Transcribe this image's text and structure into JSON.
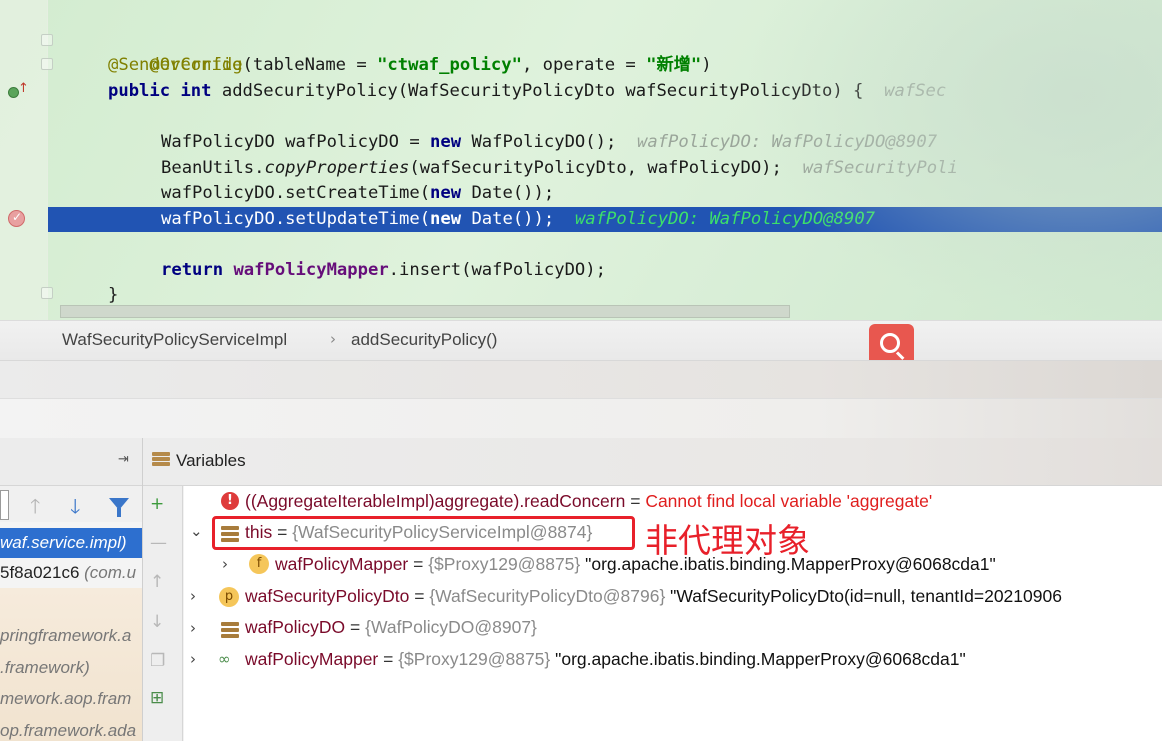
{
  "editor": {
    "lines": {
      "l1": "@Override",
      "l2_ann": "@SenderConfig",
      "l2_a": "(tableName = ",
      "l2_str1": "\"ctwaf_policy\"",
      "l2_b": ", operate = ",
      "l2_str2": "\"新增\"",
      "l2_c": ")",
      "l3_kw1": "public",
      "l3_kw2": "int",
      "l3_rest": " addSecurityPolicy(WafSecurityPolicyDto wafSecurityPolicyDto) {",
      "l3_inlay": "wafSec",
      "l5_a": "WafPolicyDO wafPolicyDO = ",
      "l5_kw": "new",
      "l5_b": " WafPolicyDO();",
      "l5_inlay": "wafPolicyDO: WafPolicyDO@8907",
      "l6_a": "BeanUtils.",
      "l6_it": "copyProperties",
      "l6_b": "(wafSecurityPolicyDto, wafPolicyDO);",
      "l6_inlay": "wafSecurityPoli",
      "l7_a": "wafPolicyDO.setCreateTime(",
      "l7_kw": "new",
      "l7_b": " Date());",
      "l8_a": "wafPolicyDO.setUpdateTime(",
      "l8_kw": "new",
      "l8_b": " Date());",
      "l8_inlay": "wafPolicyDO: WafPolicyDO@8907",
      "l10_kw": "return",
      "l10_field": "wafPolicyMapper",
      "l10_rest": ".insert(wafPolicyDO);",
      "l11": "}"
    }
  },
  "breadcrumbs": {
    "class_name": "WafSecurityPolicyServiceImpl",
    "separator": "›",
    "method_name": "addSecurityPolicy()"
  },
  "frames": {
    "selected": "waf.service.impl)",
    "row2_a": "5f8a021c6",
    "row2_b": "(com.u",
    "row3": "pringframework.a",
    "row4": ".framework)",
    "row5": "mework.aop.fram",
    "row6": "op.framework.ada"
  },
  "variables": {
    "title": "Variables",
    "rows": [
      {
        "name": "((AggregateIterableImpl)aggregate).readConcern",
        "eq": " = ",
        "value": "Cannot find local variable 'aggregate'"
      },
      {
        "name": "this",
        "eq": " = ",
        "type": "{WafSecurityPolicyServiceImpl@8874}"
      },
      {
        "name": "wafPolicyMapper",
        "eq": " = ",
        "type": "{$Proxy129@8875}",
        "value": " \"org.apache.ibatis.binding.MapperProxy@6068cda1\""
      },
      {
        "name": "wafSecurityPolicyDto",
        "eq": " = ",
        "type": "{WafSecurityPolicyDto@8796}",
        "value": " \"WafSecurityPolicyDto(id=null, tenantId=20210906"
      },
      {
        "name": "wafPolicyDO",
        "eq": " = ",
        "type": "{WafPolicyDO@8907}"
      },
      {
        "name": "wafPolicyMapper",
        "eq": " = ",
        "type": "{$Proxy129@8875}",
        "value": " \"org.apache.ibatis.binding.MapperProxy@6068cda1\""
      }
    ],
    "icon_letters": {
      "field": "f",
      "param": "p"
    }
  },
  "annotation": "非代理对象",
  "colors": {
    "exec_line": "#2154b3",
    "selected_frame": "#2d6fcf",
    "annotation_red": "#e8202a",
    "editor_bg": "#d3ecd0"
  }
}
